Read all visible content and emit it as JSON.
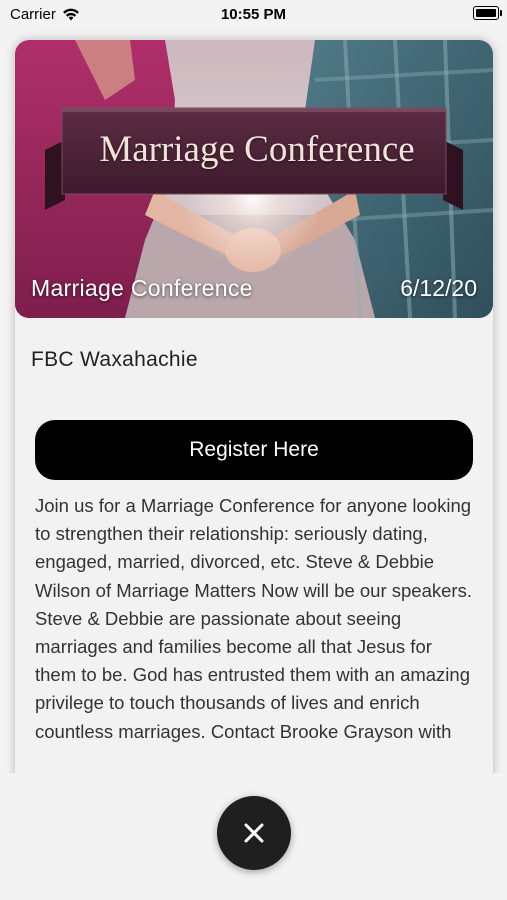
{
  "status_bar": {
    "carrier": "Carrier",
    "time": "10:55 PM"
  },
  "event": {
    "banner_text": "Marriage Conference",
    "title": "Marriage Conference",
    "date": "6/12/20",
    "location": "FBC Waxahachie",
    "register_label": "Register Here",
    "description": "Join us for a Marriage Conference for anyone looking to strengthen their relationship: seriously dating, engaged, married, divorced, etc. Steve & Debbie Wilson of Marriage Matters Now will be our speakers. Steve & Debbie are passionate about seeing marriages and families become all that Jesus for them to be. God has entrusted them with an amazing privilege to touch thousands of lives and enrich countless marriages. Contact Brooke Grayson with"
  },
  "icons": {
    "wifi": "wifi-icon",
    "battery": "battery-icon",
    "close": "close-icon"
  },
  "colors": {
    "register_bg": "#000000",
    "close_bg": "#1f1f1f",
    "banner": "#4a2336"
  }
}
